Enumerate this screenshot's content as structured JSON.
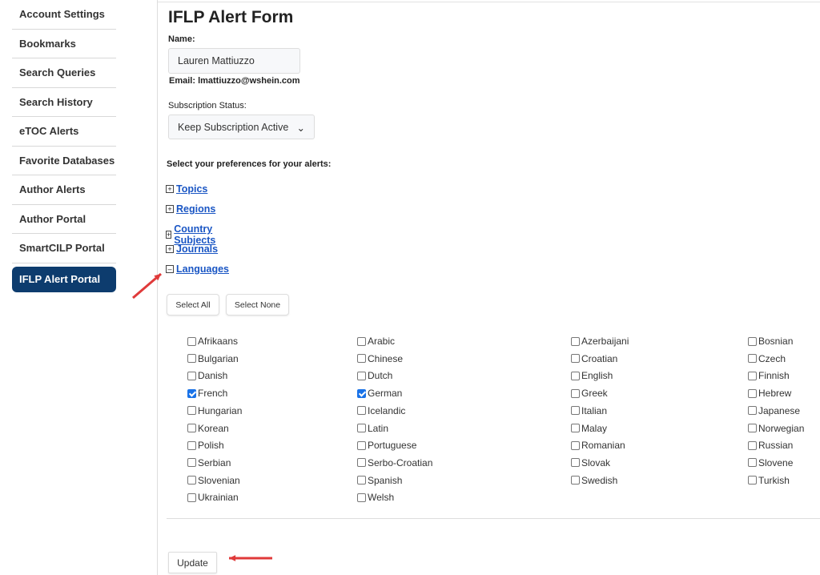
{
  "sidebar": {
    "items": [
      {
        "label": "Account Settings"
      },
      {
        "label": "Bookmarks"
      },
      {
        "label": "Search Queries"
      },
      {
        "label": "Search History"
      },
      {
        "label": "eTOC Alerts"
      },
      {
        "label": "Favorite Databases"
      },
      {
        "label": "Author Alerts"
      },
      {
        "label": "Author Portal"
      },
      {
        "label": "SmartCILP Portal"
      },
      {
        "label": "IFLP Alert Portal",
        "active": true
      }
    ]
  },
  "form": {
    "title": "IFLP Alert Form",
    "name_label": "Name:",
    "name_value": "Lauren Mattiuzzo",
    "email": "Email: lmattiuzzo@wshein.com",
    "status_label": "Subscription Status:",
    "status_value": "Keep Subscription Active",
    "prefs_label": "Select your preferences for your alerts:",
    "sections": [
      {
        "label": "Topics",
        "expanded": false
      },
      {
        "label": "Regions",
        "expanded": false
      },
      {
        "label": "Country Subjects",
        "expanded": false
      },
      {
        "label": "Journals",
        "expanded": false
      },
      {
        "label": "Languages",
        "expanded": true
      }
    ],
    "select_all": "Select All",
    "select_none": "Select None",
    "update": "Update"
  },
  "languages": [
    [
      {
        "n": "Afrikaans"
      },
      {
        "n": "Bulgarian"
      },
      {
        "n": "Danish"
      },
      {
        "n": "French",
        "c": true
      },
      {
        "n": "Hungarian"
      },
      {
        "n": "Korean"
      },
      {
        "n": "Polish"
      },
      {
        "n": "Serbian"
      },
      {
        "n": "Slovenian"
      },
      {
        "n": "Ukrainian"
      }
    ],
    [
      {
        "n": "Arabic"
      },
      {
        "n": "Chinese"
      },
      {
        "n": "Dutch"
      },
      {
        "n": "German",
        "c": true
      },
      {
        "n": "Icelandic"
      },
      {
        "n": "Latin"
      },
      {
        "n": "Portuguese"
      },
      {
        "n": "Serbo-Croatian"
      },
      {
        "n": "Spanish"
      },
      {
        "n": "Welsh"
      }
    ],
    [
      {
        "n": "Azerbaijani"
      },
      {
        "n": "Croatian"
      },
      {
        "n": "English"
      },
      {
        "n": "Greek"
      },
      {
        "n": "Italian"
      },
      {
        "n": "Malay"
      },
      {
        "n": "Romanian"
      },
      {
        "n": "Slovak"
      },
      {
        "n": "Swedish"
      }
    ],
    [
      {
        "n": "Bosnian"
      },
      {
        "n": "Czech"
      },
      {
        "n": "Finnish"
      },
      {
        "n": "Hebrew"
      },
      {
        "n": "Japanese"
      },
      {
        "n": "Norwegian"
      },
      {
        "n": "Russian"
      },
      {
        "n": "Slovene"
      },
      {
        "n": "Turkish"
      }
    ]
  ],
  "colors": {
    "accent": "#0d3c6e",
    "link": "#1a56c4",
    "checkbox": "#1a73e8",
    "annotation_arrow": "#e03a3a"
  }
}
